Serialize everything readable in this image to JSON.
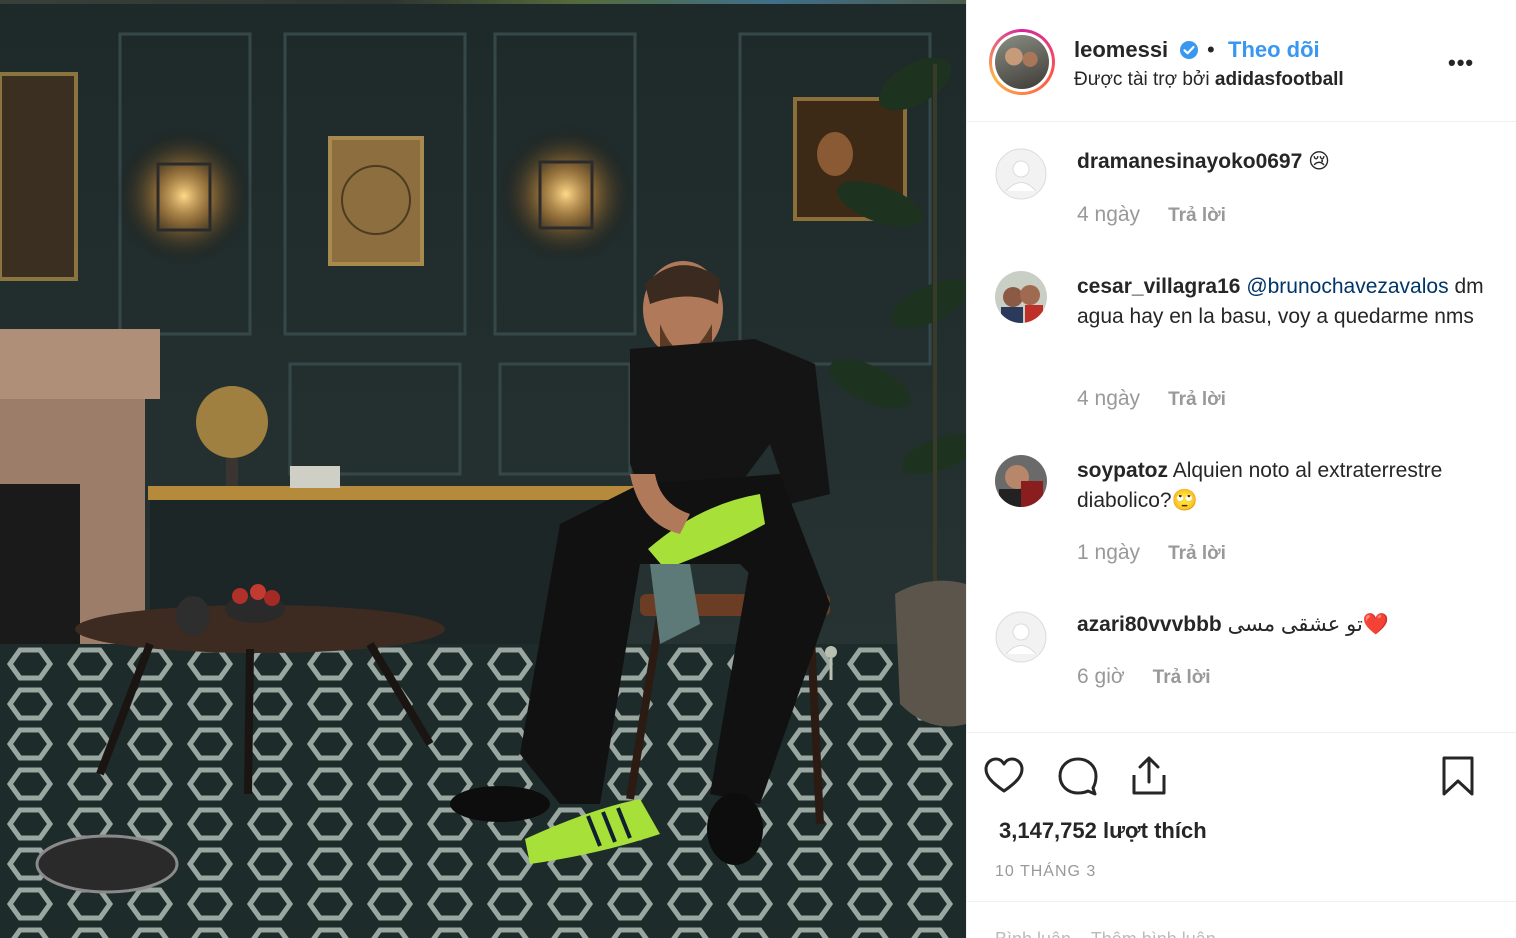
{
  "post": {
    "username": "leomessi",
    "separator": "•",
    "follow_label": "Theo dõi",
    "sponsored_prefix": "Được tài trợ bởi",
    "sponsor_name": "adidasfootball",
    "more_label": "•••"
  },
  "comments": [
    {
      "username": "dramanesinayoko0697",
      "text": "😢",
      "mention": "",
      "time": "4 ngày",
      "reply_label": "Trả lời",
      "avatar": "default-avatar-icon"
    },
    {
      "username": "cesar_villagra16",
      "mention": "@brunochavezavalos",
      "text": "dm agua hay en la basu, voy a quedarme nms",
      "time": "4 ngày",
      "reply_label": "Trả lời",
      "avatar": "user-photo"
    },
    {
      "username": "soypatoz",
      "mention": "",
      "text": "Alquien noto al extraterrestre diabolico?🙄",
      "time": "1 ngày",
      "reply_label": "Trả lời",
      "avatar": "user-photo"
    },
    {
      "username": "azari80vvvbbb",
      "mention": "",
      "text": "تو عشقی مسی❤️",
      "time": "6 giờ",
      "reply_label": "Trả lời",
      "avatar": "default-avatar-icon"
    }
  ],
  "actions": {
    "icons": [
      "heart-icon",
      "comment-icon",
      "share-icon",
      "bookmark-icon"
    ],
    "likes_label": "3,147,752 lượt thích",
    "date_label": "10 THÁNG 3",
    "footer_peek": "Bình luận... Thêm bình luận..."
  },
  "colors": {
    "link_blue": "#3897f0",
    "mention_blue": "#003569",
    "muted": "#999999",
    "text": "#262626",
    "boot_green": "#a8e03a"
  }
}
